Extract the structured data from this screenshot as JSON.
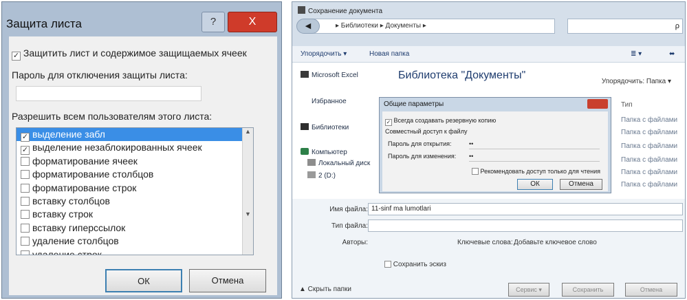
{
  "protect_sheet": {
    "title": "Защита листа",
    "help_label": "?",
    "close_label": "X",
    "protect_label": "Защитить лист и содержимое защищаемых ячеек",
    "protect_checked": true,
    "password_label": "Пароль для отключения защиты листа:",
    "password_value": "",
    "allow_label": "Разрешить всем пользователям этого листа:",
    "permissions": [
      {
        "label": "выделение забл",
        "checked": true,
        "selected": true
      },
      {
        "label": "выделение незаблокированных ячеек",
        "checked": true,
        "selected": false
      },
      {
        "label": "форматирование ячеек",
        "checked": false,
        "selected": false
      },
      {
        "label": "форматирование столбцов",
        "checked": false,
        "selected": false
      },
      {
        "label": "форматирование строк",
        "checked": false,
        "selected": false
      },
      {
        "label": "вставку столбцов",
        "checked": false,
        "selected": false
      },
      {
        "label": "вставку строк",
        "checked": false,
        "selected": false
      },
      {
        "label": "вставку гиперссылок",
        "checked": false,
        "selected": false
      },
      {
        "label": "удаление столбцов",
        "checked": false,
        "selected": false
      },
      {
        "label": "удаление строк",
        "checked": false,
        "selected": false
      }
    ],
    "ok_label": "ОК",
    "cancel_label": "Отмена"
  },
  "save_dialog": {
    "title": "Сохранение документа",
    "back_label": "◀",
    "breadcrumb": "▸ Библиотеки ▸ Документы ▸",
    "search_icon": "search-icon",
    "search_glyph": "ρ",
    "toolbar": {
      "organize_label": "Упорядочить ▾",
      "new_folder_label": "Новая папка",
      "view_label": "≣ ▾",
      "help_label": "⬌"
    },
    "nav": {
      "excel_label": "Microsoft Excel",
      "favorites_label": "Избранное",
      "libraries_label": "Библиотеки",
      "computer_label": "Компьютер",
      "local_disk_label": "Локальный диск",
      "drive2_label": "2 (D:)"
    },
    "library_heading": "Библиотека \"Документы\"",
    "arrange_label": "Упорядочить:  Папка ▾",
    "type_column": "Тип",
    "file_types": [
      "Папка с файлами",
      "Папка с файлами",
      "Папка с файлами",
      "Папка с файлами",
      "Папка с файлами",
      "Папка с файлами"
    ],
    "general_options": {
      "title": "Общие параметры",
      "backup_label": "Всегда создавать резервную копию",
      "sharing_label": "Совместный доступ к файлу",
      "open_pw_label": "Пароль для открытия:",
      "open_pw_value": "••",
      "modify_pw_label": "Пароль для изменения:",
      "modify_pw_value": "••",
      "readonly_label": "Рекомендовать доступ только для чтения",
      "ok_label": "ОК",
      "cancel_label": "Отмена"
    },
    "filename_label": "Имя файла:",
    "filename_value": "11-sinf ma lumotlari",
    "filetype_label": "Тип файла:",
    "filetype_value": "",
    "authors_label": "Авторы:",
    "keywords_label": "Ключевые слова:",
    "add_keyword_label": "Добавьте ключевое слово",
    "thumbnail_label": "Сохранить эскиз",
    "hide_folders_label": "▲ Скрыть папки",
    "service_label": "Сервис ▾",
    "save_label": "Сохранить",
    "cancel_label": "Отмена"
  }
}
